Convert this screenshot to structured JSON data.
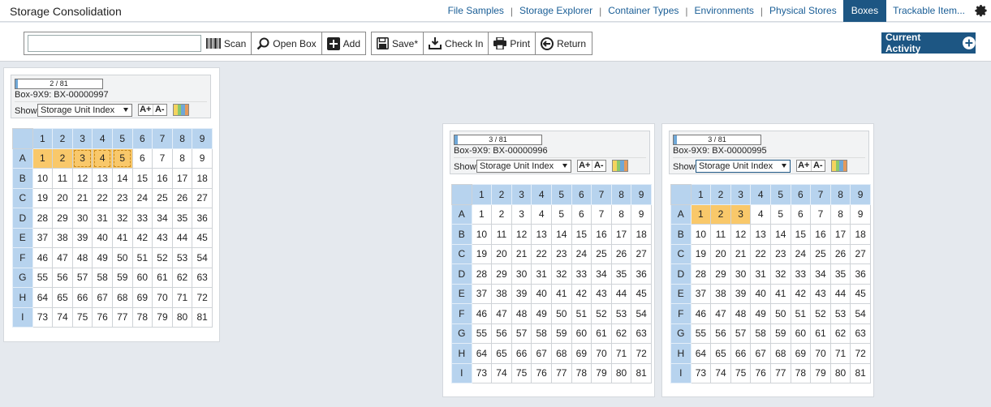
{
  "app": {
    "title": "Storage Consolidation"
  },
  "nav": {
    "items": [
      {
        "label": "File Samples",
        "active": false
      },
      {
        "label": "Storage Explorer",
        "active": false
      },
      {
        "label": "Container Types",
        "active": false
      },
      {
        "label": "Environments",
        "active": false
      },
      {
        "label": "Physical Stores",
        "active": false
      },
      {
        "label": "Boxes",
        "active": true
      },
      {
        "label": "Trackable Item...",
        "active": false
      }
    ],
    "settings_icon": "gear-icon"
  },
  "toolbar": {
    "scan_value": "",
    "scan_label": "Scan",
    "open_box_label": "Open Box",
    "add_label": "Add",
    "save_label": "Save*",
    "check_in_label": "Check In",
    "print_label": "Print",
    "return_label": "Return",
    "current_activity_label": "Current Activity"
  },
  "grid_rows": [
    "A",
    "B",
    "C",
    "D",
    "E",
    "F",
    "G",
    "H",
    "I"
  ],
  "grid_cols": [
    "1",
    "2",
    "3",
    "4",
    "5",
    "6",
    "7",
    "8",
    "9"
  ],
  "colors": {
    "accent": "#1d5683",
    "occupied": "#f9c86a",
    "header": "#b7d3ee"
  },
  "boxes": [
    {
      "progress_text": "2 / 81",
      "fill": 0.025,
      "name": "Box-9X9: BX-00000997",
      "show_label": "Show",
      "show_value": "Storage Unit Index",
      "font_up": "A+",
      "font_down": "A-",
      "occupied": [
        1,
        2
      ],
      "selected": [
        3,
        4,
        5
      ]
    },
    {
      "progress_text": "3 / 81",
      "fill": 0.037,
      "name": "Box-9X9: BX-00000996",
      "show_label": "Show",
      "show_value": "Storage Unit Index",
      "font_up": "A+",
      "font_down": "A-",
      "occupied": [],
      "selected": []
    },
    {
      "progress_text": "3 / 81",
      "fill": 0.037,
      "name": "Box-9X9: BX-00000995",
      "show_label": "Show",
      "show_value": "Storage Unit Index",
      "font_up": "A+",
      "font_down": "A-",
      "occupied": [
        1,
        2,
        3
      ],
      "selected": []
    }
  ]
}
